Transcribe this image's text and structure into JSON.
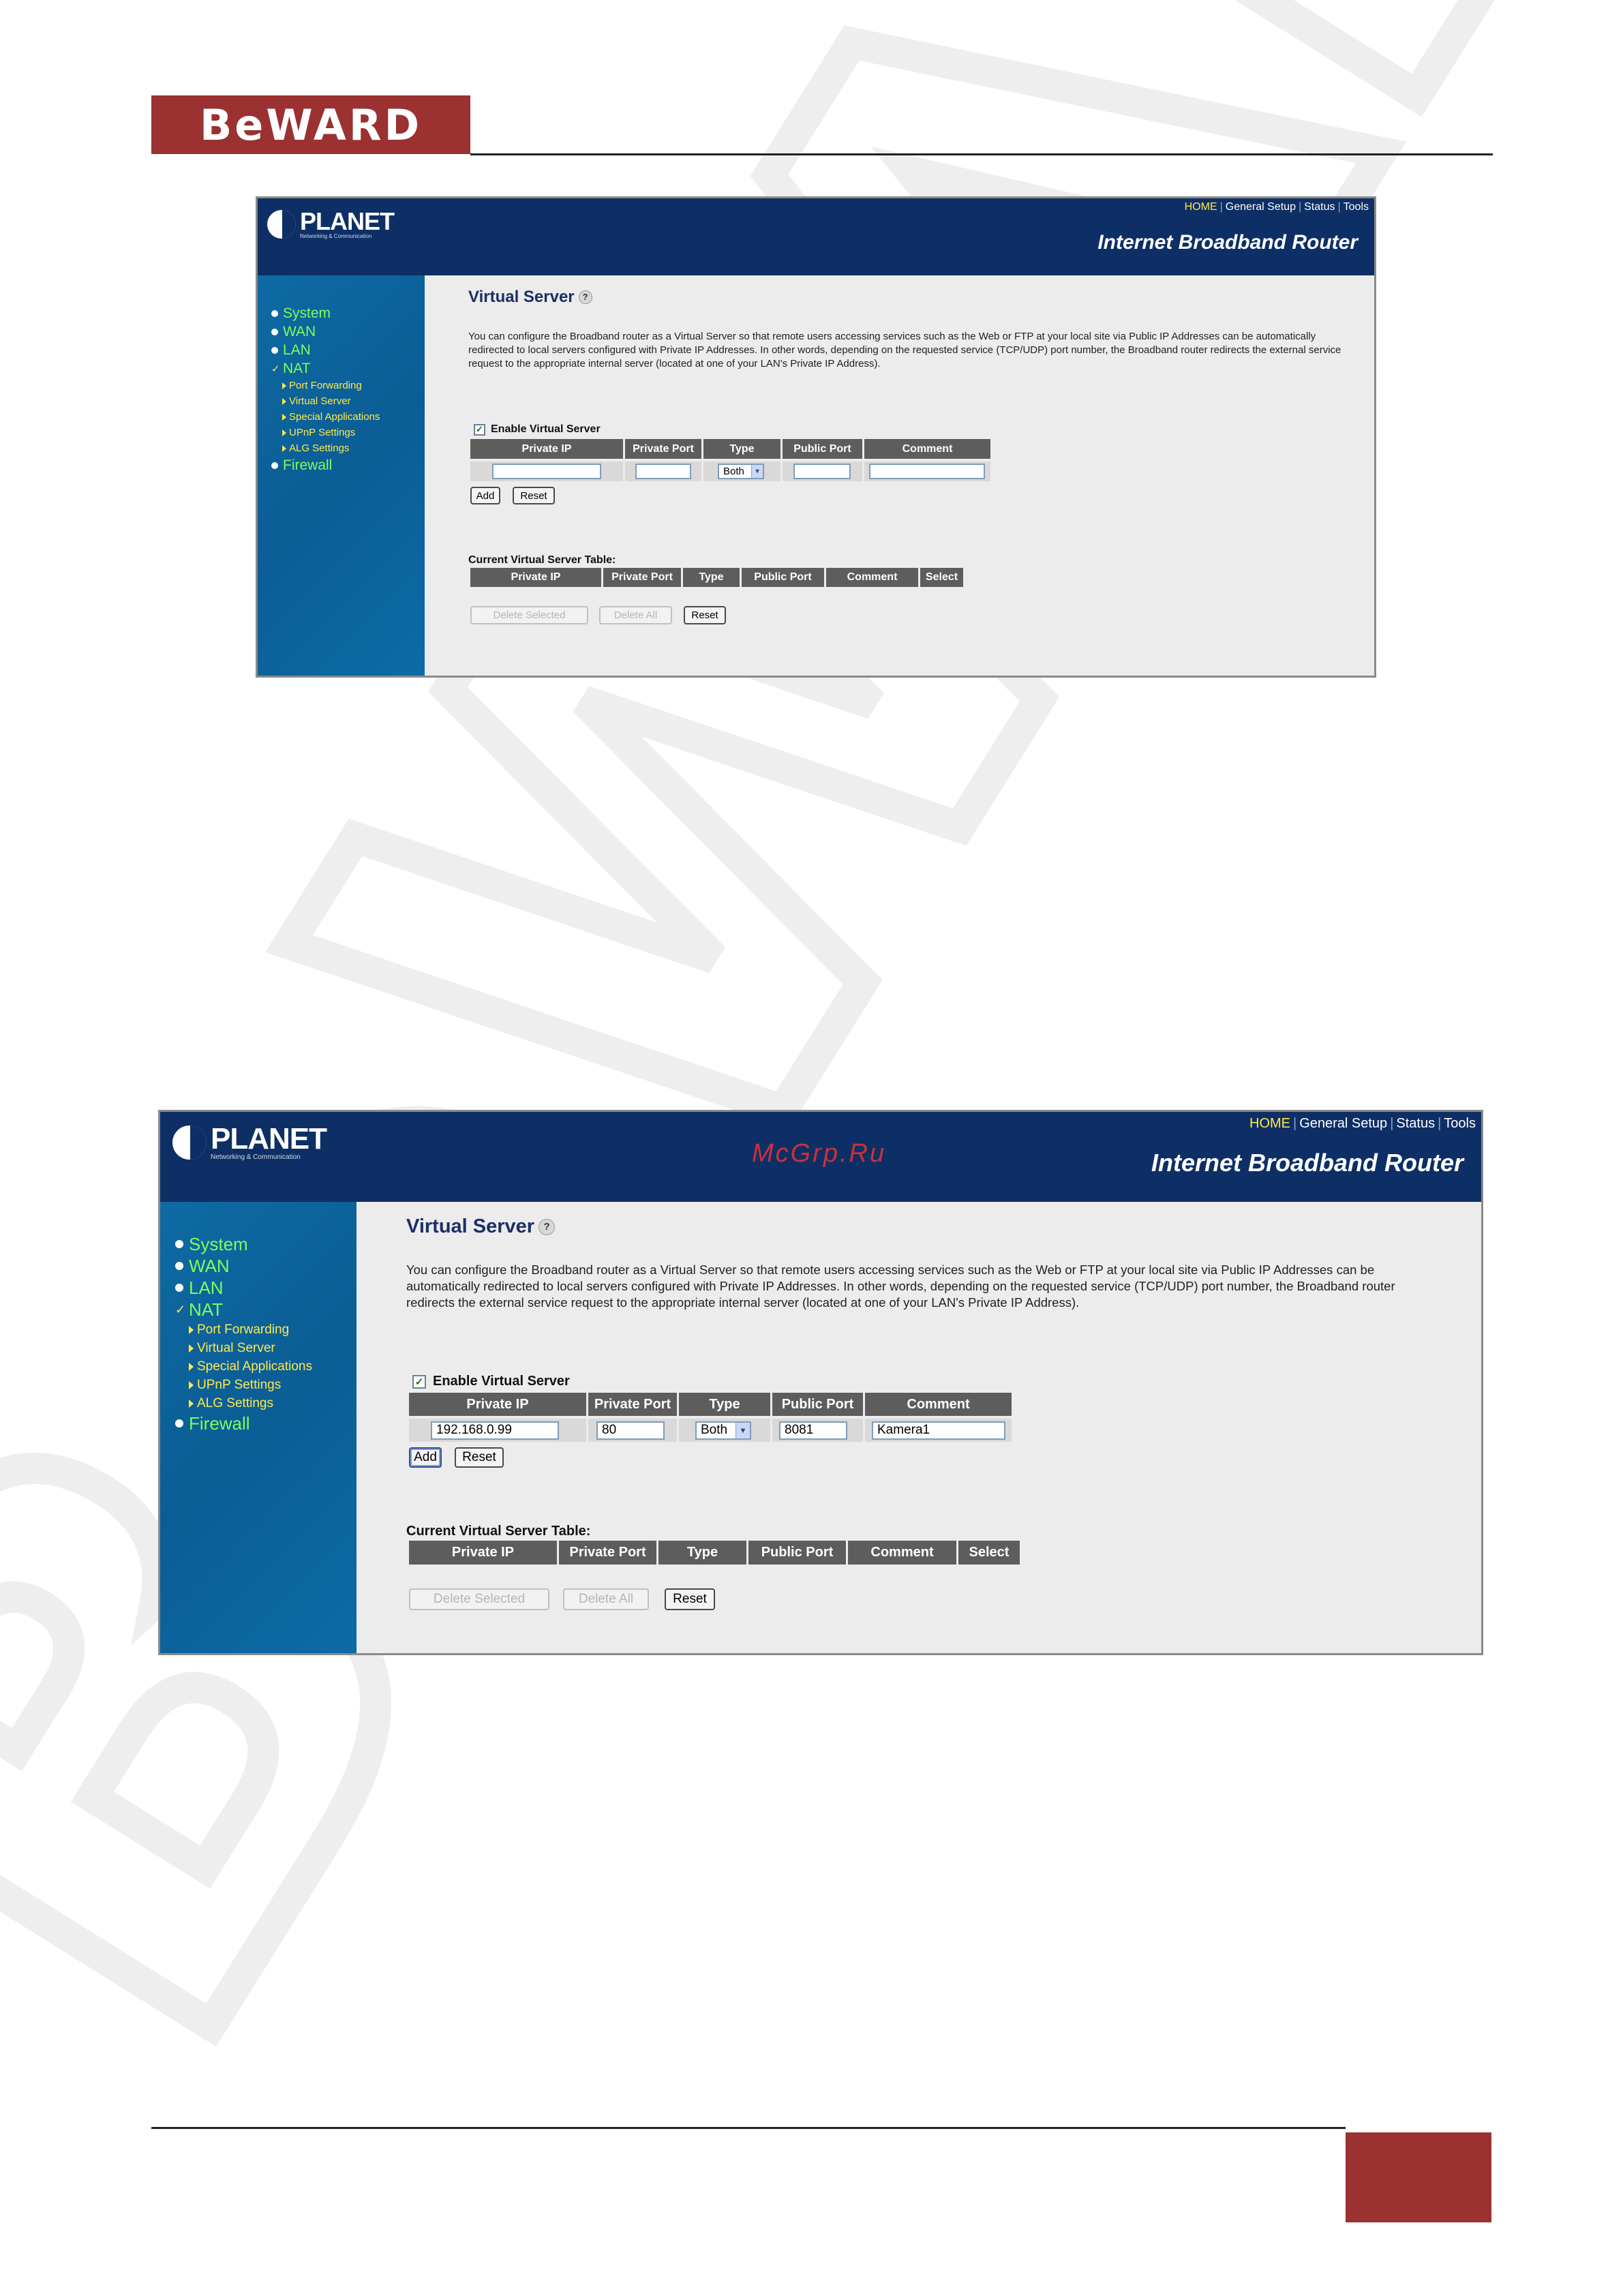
{
  "page": {
    "logo_text": "BeWARD",
    "watermark_text": "BeWARD",
    "site_mark": "McGrp.Ru"
  },
  "router": {
    "brand": "PLANET",
    "brand_tagline": "Networking & Communication",
    "top_links": [
      "HOME",
      "General Setup",
      "Status",
      "Tools"
    ],
    "product_title": "Internet Broadband Router",
    "menu": [
      {
        "label": "System",
        "marker": "dot",
        "level": 1
      },
      {
        "label": "WAN",
        "marker": "dot",
        "level": 1
      },
      {
        "label": "LAN",
        "marker": "dot",
        "level": 1
      },
      {
        "label": "NAT",
        "marker": "check",
        "level": 1
      },
      {
        "label": "Port Forwarding",
        "marker": "arrow",
        "level": 2
      },
      {
        "label": "Virtual Server",
        "marker": "arrow",
        "level": 2
      },
      {
        "label": "Special Applications",
        "marker": "arrow",
        "level": 2
      },
      {
        "label": "UPnP Settings",
        "marker": "arrow",
        "level": 2
      },
      {
        "label": "ALG Settings",
        "marker": "arrow",
        "level": 2
      },
      {
        "label": "Firewall",
        "marker": "dot",
        "level": 1
      }
    ],
    "page_title": "Virtual Server",
    "help_icon_label": "?",
    "description": "You can configure the Broadband router as a Virtual Server so that remote users accessing services such as the Web or FTP at your local site via Public IP Addresses can be automatically redirected to local servers configured with Private IP Addresses. In other words, depending on the requested service (TCP/UDP) port number, the Broadband router redirects the external service request to the appropriate internal server (located at one of your LAN's Private IP Address).",
    "enable_label": "Enable Virtual Server",
    "enable_checked": true,
    "form_columns": [
      "Private IP",
      "Private Port",
      "Type",
      "Public Port",
      "Comment"
    ],
    "type_options_selected": "Both",
    "add_label": "Add",
    "reset_label": "Reset",
    "current_table_label": "Current Virtual Server Table:",
    "table_columns": [
      "Private IP",
      "Private Port",
      "Type",
      "Public Port",
      "Comment",
      "Select"
    ],
    "delete_selected_label": "Delete Selected",
    "delete_all_label": "Delete All"
  },
  "screenshots": [
    {
      "form_values": {
        "private_ip": "",
        "private_port": "",
        "type": "Both",
        "public_port": "",
        "comment": ""
      }
    },
    {
      "form_values": {
        "private_ip": "192.168.0.99",
        "private_port": "80",
        "type": "Both",
        "public_port": "8081",
        "comment": "Kamera1"
      }
    }
  ],
  "colors": {
    "beward_red": "#9b3131",
    "router_header": "#0e2f66",
    "router_sidebar": "#0f6aa3",
    "menu_green": "#7dff5a",
    "menu_yellow": "#ffe94d"
  }
}
